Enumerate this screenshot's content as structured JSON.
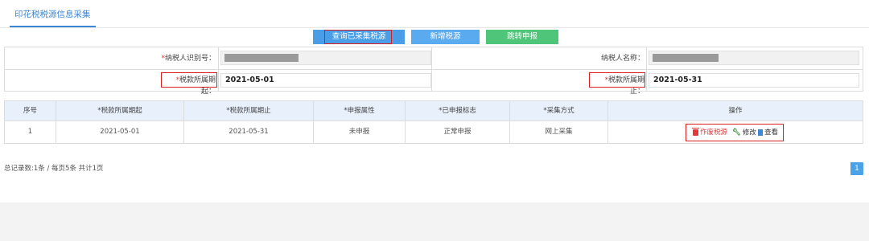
{
  "tab": {
    "label": "印花税税源信息采集"
  },
  "toolbar": {
    "query_label": "查询已采集税源",
    "add_label": "新增税源",
    "jump_label": "跳转申报"
  },
  "form": {
    "taxpayer_id_label": "纳税人识别号：",
    "taxpayer_name_label": "纳税人名称：",
    "period_start_label": "税款所属期起：",
    "period_start_value": "2021-05-01",
    "period_end_label": "税款所属期止：",
    "period_end_value": "2021-05-31",
    "required_mark": "*"
  },
  "table": {
    "headers": [
      "序号",
      "*税款所属期起",
      "*税款所属期止",
      "*申报属性",
      "*已申报标志",
      "*采集方式",
      "操作"
    ],
    "rows": [
      [
        "1",
        "2021-05-01",
        "2021-05-31",
        "未申报",
        "正常申报",
        "网上采集"
      ]
    ],
    "actions": {
      "delete": "作废税源",
      "edit": "修改",
      "view": "查看"
    }
  },
  "pager": {
    "summary": "总记录数:1条 / 每页5条 共计1页",
    "current_page": "1"
  },
  "colors": {
    "accent": "#3b87d6",
    "required": "#e03a3a",
    "highlight_box": "#d81e1e",
    "jump_button": "#4fc57a"
  }
}
